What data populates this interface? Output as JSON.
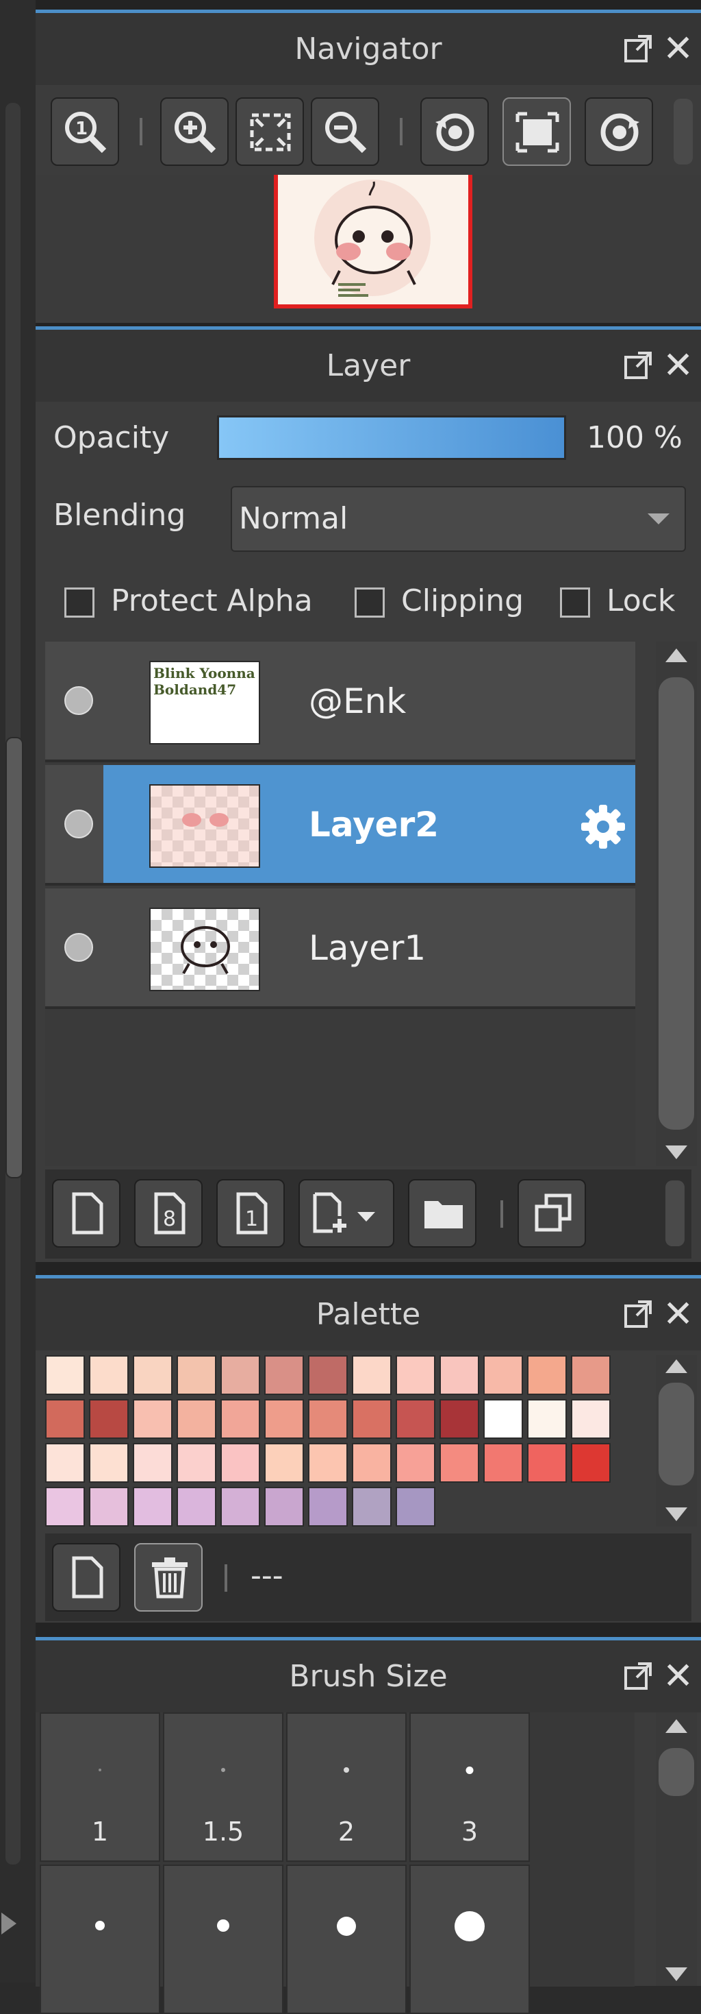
{
  "colors": {
    "accent": "#4c8fc8",
    "selected_row": "#4f94d0",
    "panel_bg": "#3c3c3c"
  },
  "navigator": {
    "title": "Navigator",
    "tools": [
      "zoom-actual-icon",
      "zoom-in-icon",
      "fit-screen-icon",
      "zoom-out-icon",
      "rotate-left-icon",
      "fit-window-icon",
      "rotate-right-icon"
    ]
  },
  "layer": {
    "title": "Layer",
    "opacity_label": "Opacity",
    "opacity_value": "100 %",
    "opacity_fraction": 1.0,
    "blending_label": "Blending",
    "blending_value": "Normal",
    "checks": [
      {
        "label": "Protect Alpha",
        "checked": false
      },
      {
        "label": "Clipping",
        "checked": false
      },
      {
        "label": "Lock",
        "checked": false
      }
    ],
    "layers": [
      {
        "name": "@Enk",
        "selected": false,
        "thumb_text": "Blink Yoonna Boldand47"
      },
      {
        "name": "Layer2",
        "selected": true
      },
      {
        "name": "Layer1",
        "selected": false
      }
    ],
    "tools": [
      "new-layer-icon",
      "new-8bit-layer-icon",
      "new-1bit-layer-icon",
      "add-layer-menu-icon",
      "new-folder-icon",
      "duplicate-layer-icon"
    ]
  },
  "palette": {
    "title": "Palette",
    "palette_name": "---",
    "swatches": [
      [
        "#fde6d8",
        "#fcdccb",
        "#f9d4c1",
        "#f3c3ad",
        "#e7ada0",
        "#d99087",
        "#bf6b66",
        "#fcd7c8",
        "#fbc9bf",
        "#f9c5be",
        "#f7b9a8",
        "#f4a88d",
        "#e79a89"
      ],
      [
        "#d26a5c",
        "#b84943",
        "#f8bfb0",
        "#f3b29f",
        "#f1a698",
        "#ee9d8b",
        "#e58a79",
        "#d97163",
        "#c65552",
        "#a83438",
        "#ffffff",
        "#fdf4ec",
        "#fce8e3"
      ],
      [
        "#fde3d9",
        "#fde0d2",
        "#fcdcd7",
        "#fbd0cd",
        "#fac3c3",
        "#fcd0ba",
        "#fcc5b0",
        "#f9b3a1",
        "#f7a197",
        "#f48b80",
        "#f27870",
        "#ef645f",
        "#dd3832"
      ],
      [
        "#eac5e2",
        "#e6bfdc",
        "#e2bde0",
        "#dab5dc",
        "#d4b0d6",
        "#c9a6cf",
        "#b69bc9",
        "#b0a2c2",
        "#a697c2"
      ]
    ]
  },
  "brush": {
    "title": "Brush Size",
    "sizes": [
      {
        "label": "1"
      },
      {
        "label": "1.5"
      },
      {
        "label": "2"
      },
      {
        "label": "3"
      },
      {
        "label": ""
      },
      {
        "label": ""
      },
      {
        "label": ""
      },
      {
        "label": ""
      }
    ]
  }
}
